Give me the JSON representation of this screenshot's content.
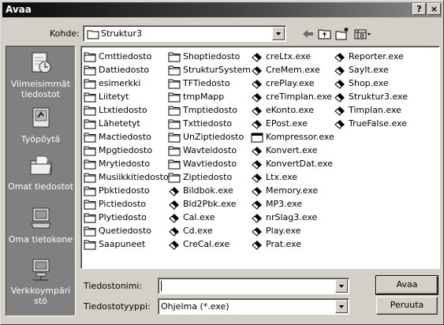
{
  "dialog": {
    "title": "Avaa",
    "help_glyph": "?",
    "close_glyph": "×"
  },
  "look_in": {
    "label": "Kohde:",
    "value": "Struktur3"
  },
  "places": [
    {
      "label": "Viimeisimmät tiedostot",
      "icon": "recent-documents-icon"
    },
    {
      "label": "Työpöytä",
      "icon": "desktop-icon"
    },
    {
      "label": "Omat tiedostot",
      "icon": "my-documents-icon"
    },
    {
      "label": "Oma tietokone",
      "icon": "my-computer-icon"
    },
    {
      "label": "Verkkoympäristö",
      "icon": "network-places-icon"
    }
  ],
  "files": {
    "col1": [
      "Cmttiedosto",
      "Dattiedosto",
      "esimerkki",
      "Liitetyt",
      "Ltxtiedosto",
      "Lähetetyt",
      "Mactiedosto",
      "Mpgtiedosto",
      "Mrytiedosto",
      "Musiikkitiedosto",
      "Pbktiedosto",
      "Pictiedosto",
      "Plytiedosto",
      "Quetiedosto",
      "Saapuneet"
    ],
    "col2_folders": [
      "Shoptiedosto",
      "StrukturSystem",
      "TFTiedosto",
      "tmpMapp",
      "Tmptiedosto",
      "Txttiedosto",
      "UnZiptiedosto",
      "Wavteidosto",
      "Wavtiedosto",
      "Ziptiedosto"
    ],
    "col2_exes": [
      "Bildbok.exe",
      "Bld2Pbk.exe",
      "Cal.exe",
      "Cd.exe",
      "CreCal.exe"
    ],
    "col3": [
      "creLtx.exe",
      "CreMem.exe",
      "crePlay.exe",
      "creTimplan.exe",
      "eKonto.exe",
      "EPost.exe",
      "Kompressor.exe",
      "Konvert.exe",
      "KonvertDat.exe",
      "Ltx.exe",
      "Memory.exe",
      "MP3.exe",
      "nrSlag3.exe",
      "Play.exe",
      "Prat.exe"
    ],
    "col4": [
      "Reporter.exe",
      "SayIt.exe",
      "Shop.exe",
      "Struktur3.exe",
      "Timplan.exe",
      "TrueFalse.exe"
    ]
  },
  "filename": {
    "label": "Tiedostonimi:",
    "value": ""
  },
  "filetype": {
    "label": "Tiedostotyyppi:",
    "value": "Ohjelma (*.exe)"
  },
  "buttons": {
    "open": "Avaa",
    "cancel": "Peruuta"
  }
}
